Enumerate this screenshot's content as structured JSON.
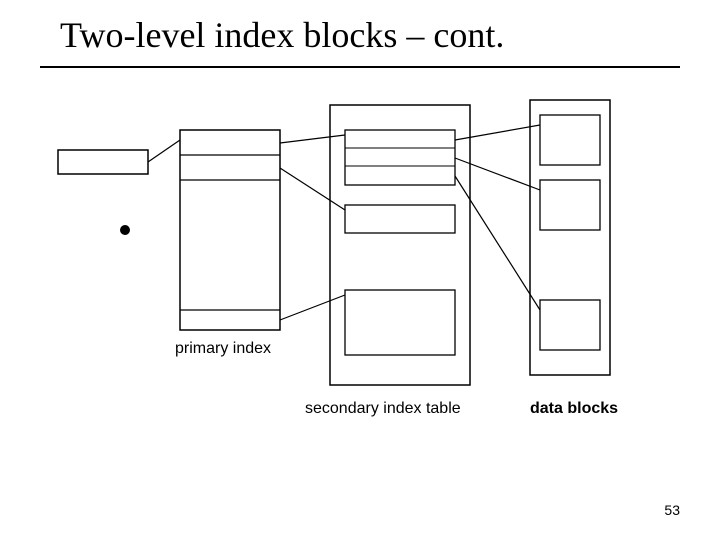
{
  "title": "Two-level index blocks – cont.",
  "labels": {
    "primary": "primary index",
    "secondary": "secondary index table",
    "datablocks": "data blocks"
  },
  "page_number": "53"
}
